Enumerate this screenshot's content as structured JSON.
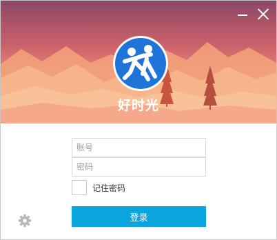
{
  "app": {
    "name": "好时光"
  },
  "window_controls": {
    "minimize_icon": "minimize-icon",
    "close_icon": "close-icon"
  },
  "form": {
    "account_placeholder": "账号",
    "password_placeholder": "密码",
    "account_value": "",
    "password_value": "",
    "remember_label": "记住密码",
    "remember_checked": false,
    "login_label": "登录"
  },
  "footer": {
    "settings_icon": "gear-icon"
  },
  "colors": {
    "accent": "#0aa4df",
    "logo_blue": "#1e74d8",
    "sky_top": "#8f4a66",
    "sky_bottom": "#f6a77d"
  }
}
